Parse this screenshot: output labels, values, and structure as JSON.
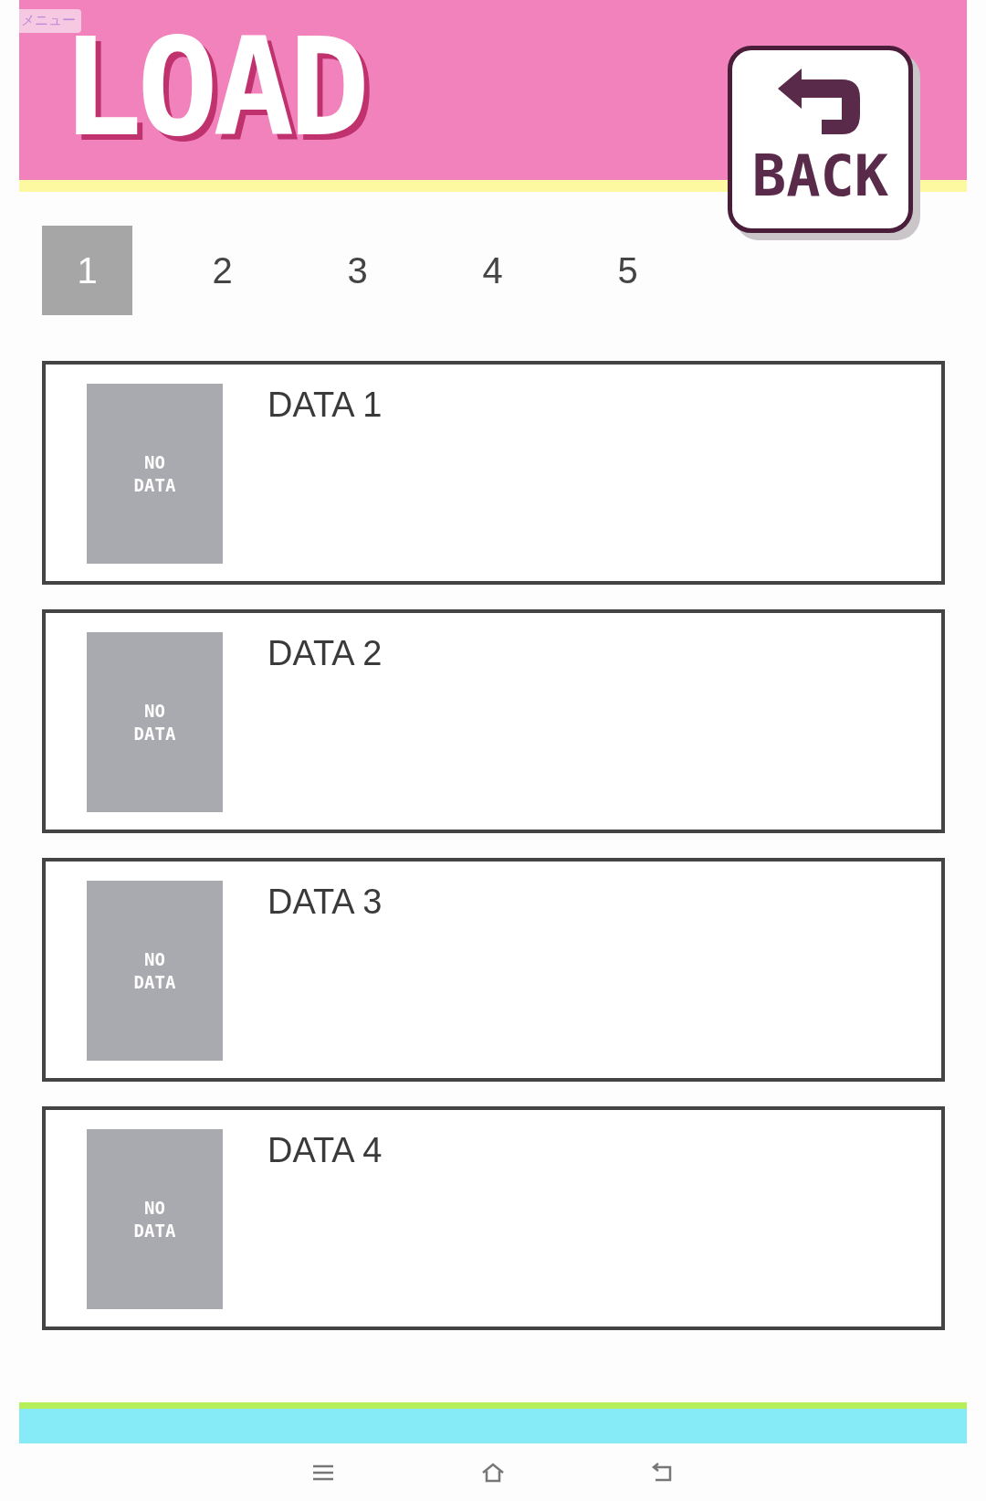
{
  "menu_label": "メニュー",
  "title": "LOAD",
  "back_button": {
    "label": "BACK"
  },
  "tabs": [
    {
      "label": "1",
      "selected": true
    },
    {
      "label": "2",
      "selected": false
    },
    {
      "label": "3",
      "selected": false
    },
    {
      "label": "4",
      "selected": false
    },
    {
      "label": "5",
      "selected": false
    }
  ],
  "slots": [
    {
      "title": "DATA 1",
      "thumbnail": "NO DATA"
    },
    {
      "title": "DATA 2",
      "thumbnail": "NO DATA"
    },
    {
      "title": "DATA 3",
      "thumbnail": "NO DATA"
    },
    {
      "title": "DATA 4",
      "thumbnail": "NO DATA"
    }
  ]
}
